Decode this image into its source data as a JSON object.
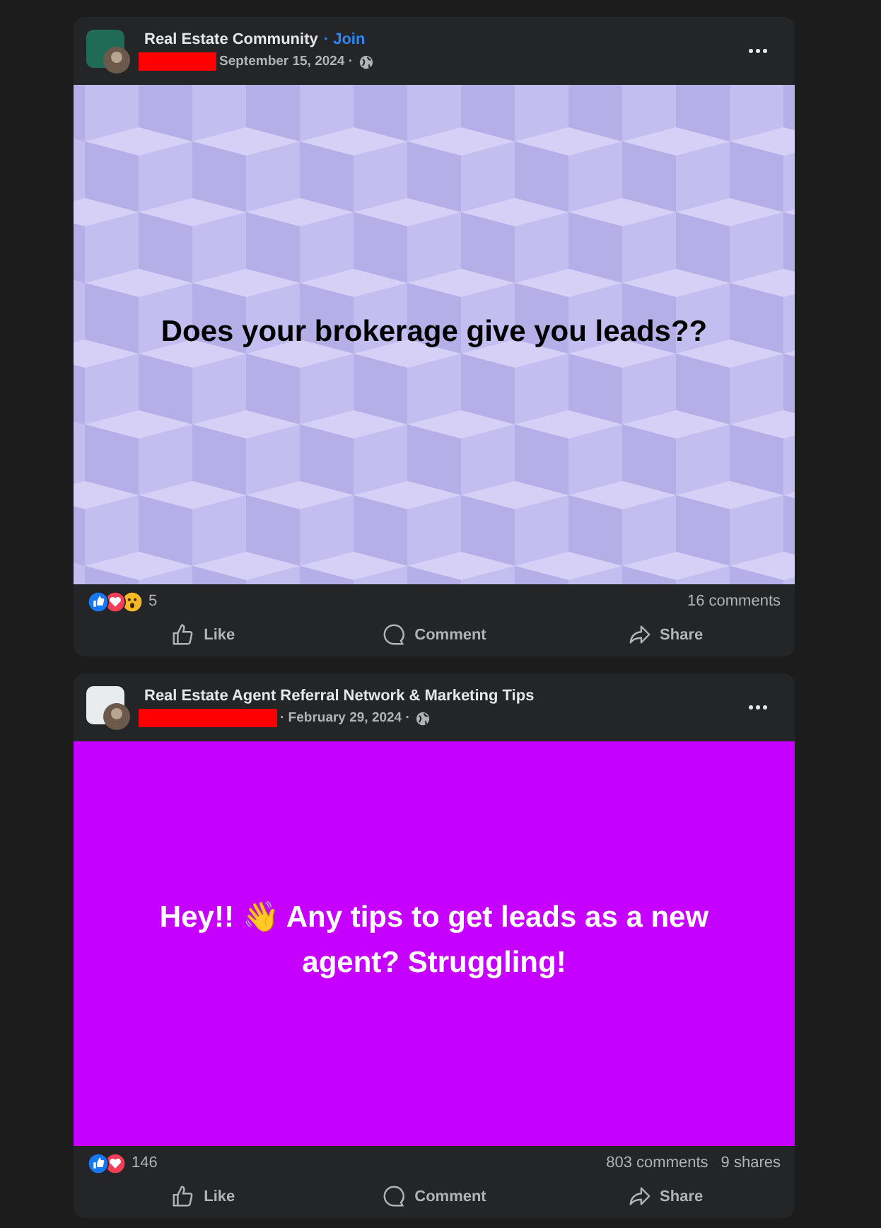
{
  "posts": [
    {
      "group": "Real Estate Community",
      "join": "· Join",
      "author_redacted": true,
      "date": "September 15, 2024 ·",
      "background": {
        "kind": "cubes",
        "color": "#c4bdf0"
      },
      "text": "Does your brokerage give you leads??",
      "reactions": [
        {
          "kind": "like"
        },
        {
          "kind": "love"
        },
        {
          "kind": "wow"
        }
      ],
      "reaction_count": "5",
      "stats": [
        "16 comments"
      ],
      "actions": [
        "Like",
        "Comment",
        "Share"
      ]
    },
    {
      "group": "Real Estate Agent Referral Network & Marketing Tips",
      "author_redacted": true,
      "date": "· February 29, 2024 ·",
      "background": {
        "kind": "solid",
        "color": "#c600ff"
      },
      "text": "Hey!! 👋 Any tips to get leads as a new agent? Struggling!",
      "reactions": [
        {
          "kind": "like"
        },
        {
          "kind": "love"
        }
      ],
      "reaction_count": "146",
      "stats": [
        "803 comments",
        "9 shares"
      ],
      "actions": [
        "Like",
        "Comment",
        "Share"
      ]
    }
  ]
}
